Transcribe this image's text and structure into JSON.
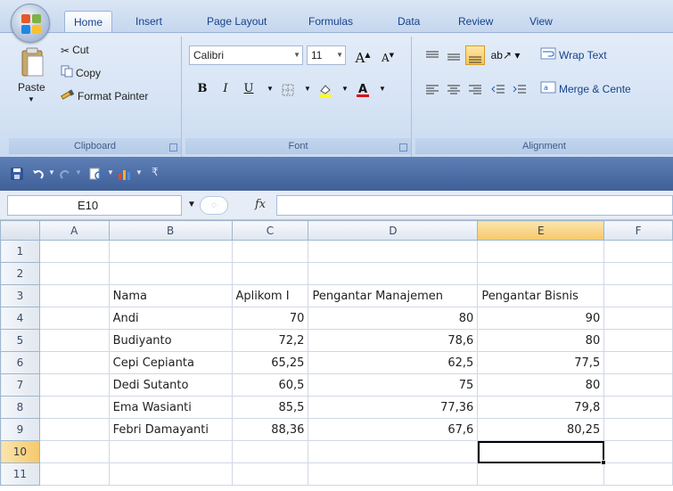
{
  "tabs": [
    {
      "label": "Home",
      "active": true
    },
    {
      "label": "Insert",
      "active": false
    },
    {
      "label": "Page Layout",
      "active": false
    },
    {
      "label": "Formulas",
      "active": false
    },
    {
      "label": "Data",
      "active": false
    },
    {
      "label": "Review",
      "active": false
    },
    {
      "label": "View",
      "active": false
    }
  ],
  "ribbon": {
    "clipboard": {
      "label": "Clipboard",
      "paste": "Paste",
      "cut": "Cut",
      "copy": "Copy",
      "format_painter": "Format Painter"
    },
    "font": {
      "label": "Font",
      "font_name": "Calibri",
      "font_size": "11",
      "bold": "B",
      "italic": "I",
      "underline": "U"
    },
    "alignment": {
      "label": "Alignment",
      "wrap_text": "Wrap Text",
      "merge_center": "Merge & Cente"
    }
  },
  "formula_bar": {
    "name_box": "E10",
    "fx": "fx",
    "formula": ""
  },
  "grid": {
    "columns": [
      "A",
      "B",
      "C",
      "D",
      "E",
      "F"
    ],
    "selected_column": "E",
    "selected_row": "10",
    "active_cell": "E10",
    "rows": [
      {
        "row": "1",
        "cells": [
          "",
          "",
          "",
          "",
          "",
          ""
        ]
      },
      {
        "row": "2",
        "cells": [
          "",
          "",
          "",
          "",
          "",
          ""
        ]
      },
      {
        "row": "3",
        "cells": [
          "",
          "Nama",
          "Aplikom I",
          "Pengantar Manajemen",
          "Pengantar Bisnis",
          ""
        ]
      },
      {
        "row": "4",
        "cells": [
          "",
          "Andi",
          "70",
          "80",
          "90",
          ""
        ]
      },
      {
        "row": "5",
        "cells": [
          "",
          "Budiyanto",
          "72,2",
          "78,6",
          "80",
          ""
        ]
      },
      {
        "row": "6",
        "cells": [
          "",
          "Cepi Cepianta",
          "65,25",
          "62,5",
          "77,5",
          ""
        ]
      },
      {
        "row": "7",
        "cells": [
          "",
          "Dedi Sutanto",
          "60,5",
          "75",
          "80",
          ""
        ]
      },
      {
        "row": "8",
        "cells": [
          "",
          "Ema Wasianti",
          "85,5",
          "77,36",
          "79,8",
          ""
        ]
      },
      {
        "row": "9",
        "cells": [
          "",
          "Febri Damayanti",
          "88,36",
          "67,6",
          "80,25",
          ""
        ]
      },
      {
        "row": "10",
        "cells": [
          "",
          "",
          "",
          "",
          "",
          ""
        ]
      },
      {
        "row": "11",
        "cells": [
          "",
          "",
          "",
          "",
          "",
          ""
        ]
      }
    ]
  },
  "colors": {
    "accent": "#15428b",
    "selected_header": "#f5c86b",
    "qat_bar": "#4a6ca6"
  }
}
